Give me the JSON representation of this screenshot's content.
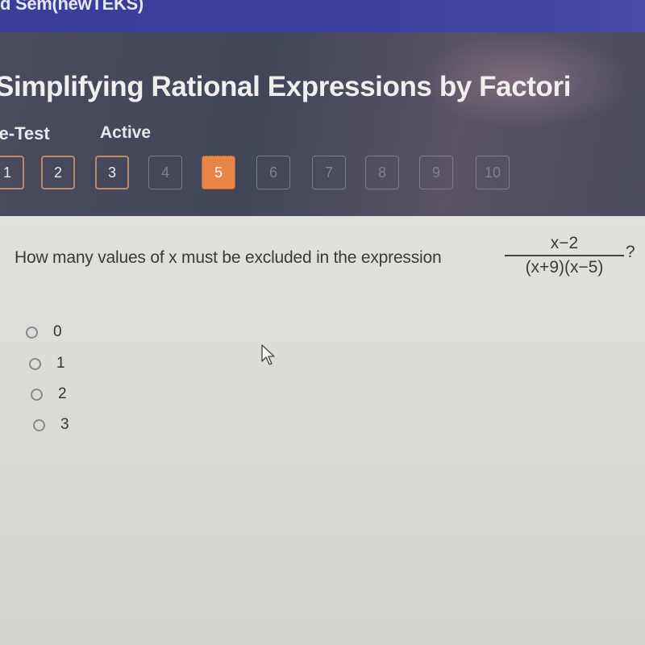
{
  "topbar": {
    "course": "d Sem(newTEKS)"
  },
  "header": {
    "title": "Simplifying Rational Expressions by Factori",
    "mode": "re-Test",
    "status": "Active"
  },
  "nav": {
    "questions": [
      {
        "label": "1",
        "state": "answered"
      },
      {
        "label": "2",
        "state": "answered"
      },
      {
        "label": "3",
        "state": "answered"
      },
      {
        "label": "4",
        "state": "locked"
      },
      {
        "label": "5",
        "state": "current"
      },
      {
        "label": "6",
        "state": "locked"
      },
      {
        "label": "7",
        "state": "locked"
      },
      {
        "label": "8",
        "state": "locked"
      },
      {
        "label": "9",
        "state": "locked"
      },
      {
        "label": "10",
        "state": "locked"
      }
    ],
    "accent": "#e8864a"
  },
  "question": {
    "prompt": "How many values of x must be excluded in the expression",
    "numerator": "x−2",
    "denominator": "(x+9)(x−5)",
    "end": "?",
    "options": [
      "0",
      "1",
      "2",
      "3"
    ]
  },
  "icons": {
    "cursor": "mouse-pointer-icon"
  }
}
